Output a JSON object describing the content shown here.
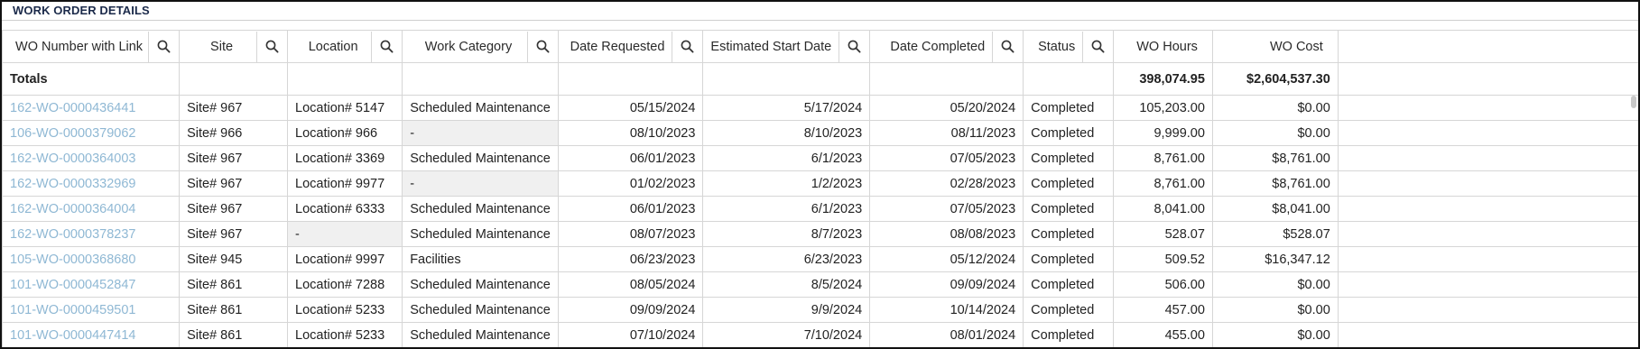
{
  "section": {
    "title": "WORK ORDER DETAILS"
  },
  "columns": [
    {
      "label": "WO Number with Link",
      "searchable": true
    },
    {
      "label": "Site",
      "searchable": true
    },
    {
      "label": "Location",
      "searchable": true
    },
    {
      "label": "Work Category",
      "searchable": true
    },
    {
      "label": "Date Requested",
      "searchable": true
    },
    {
      "label": "Estimated Start Date",
      "searchable": true
    },
    {
      "label": "Date Completed",
      "searchable": true
    },
    {
      "label": "Status",
      "searchable": true
    },
    {
      "label": "WO Hours",
      "searchable": false
    },
    {
      "label": "WO Cost",
      "searchable": false
    }
  ],
  "totals": {
    "label": "Totals",
    "wo_hours": "398,074.95",
    "wo_cost": "$2,604,537.30"
  },
  "rows": [
    {
      "wo": "162-WO-0000436441",
      "site": "Site# 967",
      "location": "Location# 5147",
      "category": "Scheduled Maintenance",
      "requested": "05/15/2024",
      "est_start": "5/17/2024",
      "completed": "05/20/2024",
      "status": "Completed",
      "hours": "105,203.00",
      "cost": "$0.00"
    },
    {
      "wo": "106-WO-0000379062",
      "site": "Site# 966",
      "location": "Location# 966",
      "category": "-",
      "requested": "08/10/2023",
      "est_start": "8/10/2023",
      "completed": "08/11/2023",
      "status": "Completed",
      "hours": "9,999.00",
      "cost": "$0.00"
    },
    {
      "wo": "162-WO-0000364003",
      "site": "Site# 967",
      "location": "Location# 3369",
      "category": "Scheduled Maintenance",
      "requested": "06/01/2023",
      "est_start": "6/1/2023",
      "completed": "07/05/2023",
      "status": "Completed",
      "hours": "8,761.00",
      "cost": "$8,761.00"
    },
    {
      "wo": "162-WO-0000332969",
      "site": "Site# 967",
      "location": "Location# 9977",
      "category": "-",
      "requested": "01/02/2023",
      "est_start": "1/2/2023",
      "completed": "02/28/2023",
      "status": "Completed",
      "hours": "8,761.00",
      "cost": "$8,761.00"
    },
    {
      "wo": "162-WO-0000364004",
      "site": "Site# 967",
      "location": "Location# 6333",
      "category": "Scheduled Maintenance",
      "requested": "06/01/2023",
      "est_start": "6/1/2023",
      "completed": "07/05/2023",
      "status": "Completed",
      "hours": "8,041.00",
      "cost": "$8,041.00"
    },
    {
      "wo": "162-WO-0000378237",
      "site": "Site# 967",
      "location": "-",
      "category": "Scheduled Maintenance",
      "requested": "08/07/2023",
      "est_start": "8/7/2023",
      "completed": "08/08/2023",
      "status": "Completed",
      "hours": "528.07",
      "cost": "$528.07"
    },
    {
      "wo": "105-WO-0000368680",
      "site": "Site# 945",
      "location": "Location# 9997",
      "category": "Facilities",
      "requested": "06/23/2023",
      "est_start": "6/23/2023",
      "completed": "05/12/2024",
      "status": "Completed",
      "hours": "509.52",
      "cost": "$16,347.12"
    },
    {
      "wo": "101-WO-0000452847",
      "site": "Site# 861",
      "location": "Location# 7288",
      "category": "Scheduled Maintenance",
      "requested": "08/05/2024",
      "est_start": "8/5/2024",
      "completed": "09/09/2024",
      "status": "Completed",
      "hours": "506.00",
      "cost": "$0.00"
    },
    {
      "wo": "101-WO-0000459501",
      "site": "Site# 861",
      "location": "Location# 5233",
      "category": "Scheduled Maintenance",
      "requested": "09/09/2024",
      "est_start": "9/9/2024",
      "completed": "10/14/2024",
      "status": "Completed",
      "hours": "457.00",
      "cost": "$0.00"
    },
    {
      "wo": "101-WO-0000447414",
      "site": "Site# 861",
      "location": "Location# 5233",
      "category": "Scheduled Maintenance",
      "requested": "07/10/2024",
      "est_start": "7/10/2024",
      "completed": "08/01/2024",
      "status": "Completed",
      "hours": "455.00",
      "cost": "$0.00"
    }
  ],
  "colors": {
    "link": "#8fb8d4",
    "title": "#1b2a4a",
    "border": "#d6d6d6"
  },
  "icons": {
    "search": "search-icon"
  }
}
